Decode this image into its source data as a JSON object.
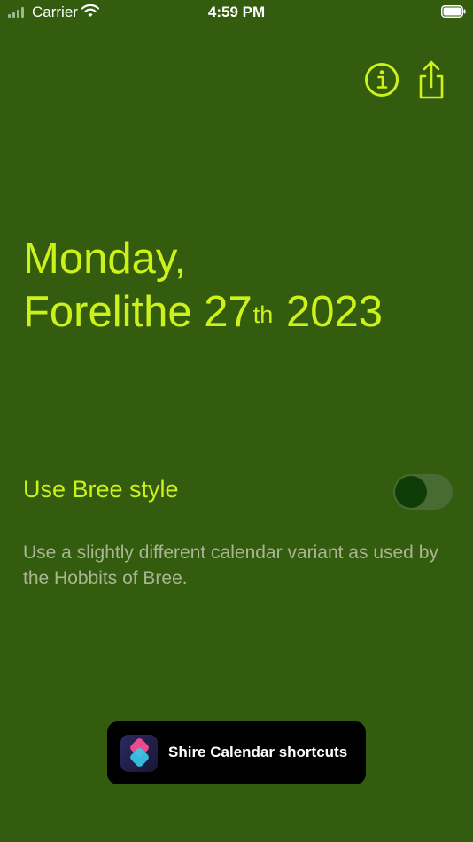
{
  "status_bar": {
    "carrier": "Carrier",
    "time": "4:59 PM"
  },
  "toolbar": {
    "info_icon": "info-circle-icon",
    "share_icon": "share-icon",
    "accent_color": "#cdf21a"
  },
  "date": {
    "line1": "Monday,",
    "month": "Forelithe",
    "day": "27",
    "ordinal_suffix": "th",
    "year": "2023"
  },
  "bree_setting": {
    "label": "Use Bree style",
    "enabled": false,
    "description": "Use a slightly different calendar variant as used by the Hobbits of Bree."
  },
  "shortcuts_button": {
    "label": "Shire Calendar shortcuts",
    "icon": "shortcuts-app-icon"
  },
  "colors": {
    "background": "#335c0f",
    "accent": "#cdf21a",
    "secondary_text": "#aab692"
  }
}
